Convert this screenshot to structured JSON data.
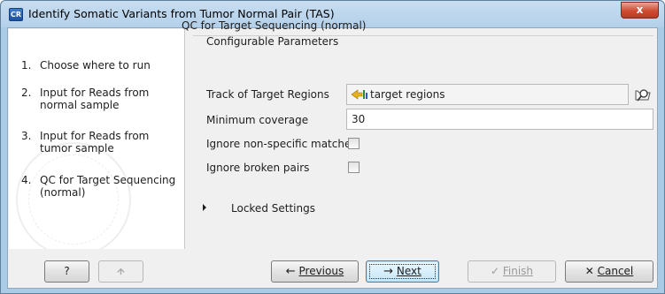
{
  "window": {
    "icon_text": "CR",
    "title": "Identify Somatic Variants from Tumor Normal Pair (TAS)",
    "close_glyph": "x"
  },
  "steps": [
    {
      "num": "1.",
      "label": "Choose where to run"
    },
    {
      "num": "2.",
      "label": "Input for Reads from normal sample"
    },
    {
      "num": "3.",
      "label": "Input for Reads from tumor sample"
    },
    {
      "num": "4.",
      "label": "QC for Target Sequencing (normal)"
    }
  ],
  "panel": {
    "heading": "QC for Target Sequencing (normal)",
    "group_title": "Configurable Parameters",
    "track_label": "Track of Target Regions",
    "track_value": "target regions",
    "min_coverage_label": "Minimum coverage",
    "min_coverage_value": "30",
    "ignore_nonspecific_label": "Ignore non-specific matches",
    "ignore_nonspecific_checked": false,
    "ignore_broken_label": "Ignore broken pairs",
    "ignore_broken_checked": false,
    "locked_label": "Locked Settings"
  },
  "buttons": {
    "help": "?",
    "previous_arrow": "←",
    "previous_label": "Previous",
    "next_arrow": "→",
    "next_label": "Next",
    "finish_check": "✓",
    "finish_label": "Finish",
    "cancel_x": "✕",
    "cancel_label": "Cancel"
  },
  "colors": {
    "titlebar": "#b3d0ea",
    "close_button": "#cf4b33",
    "focused_button": "#bee6fd"
  }
}
